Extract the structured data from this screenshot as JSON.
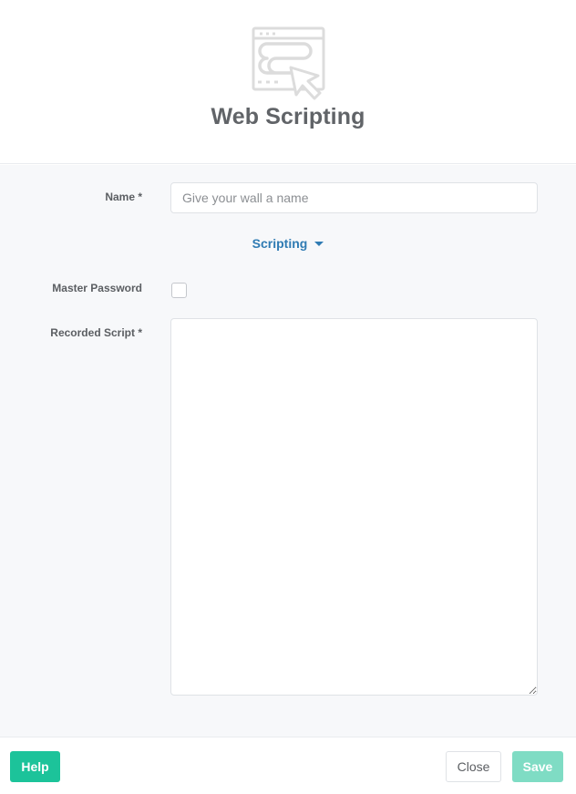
{
  "header": {
    "icon": "web-scripting-icon",
    "title": "Web Scripting"
  },
  "form": {
    "name": {
      "label": "Name *",
      "value": "",
      "placeholder": "Give your wall a name"
    },
    "section_toggle": {
      "label": "Scripting",
      "icon": "caret-down-icon",
      "color": "#2f7bb3"
    },
    "master_password": {
      "label": "Master Password",
      "checked": false
    },
    "recorded_script": {
      "label": "Recorded Script *",
      "value": ""
    }
  },
  "footer": {
    "help_label": "Help",
    "close_label": "Close",
    "save_label": "Save"
  },
  "colors": {
    "accent": "#1cc39a",
    "accent_disabled": "#7fdcc4",
    "link": "#2f7bb3",
    "title": "#616468",
    "body_background": "#f7f8fa"
  }
}
